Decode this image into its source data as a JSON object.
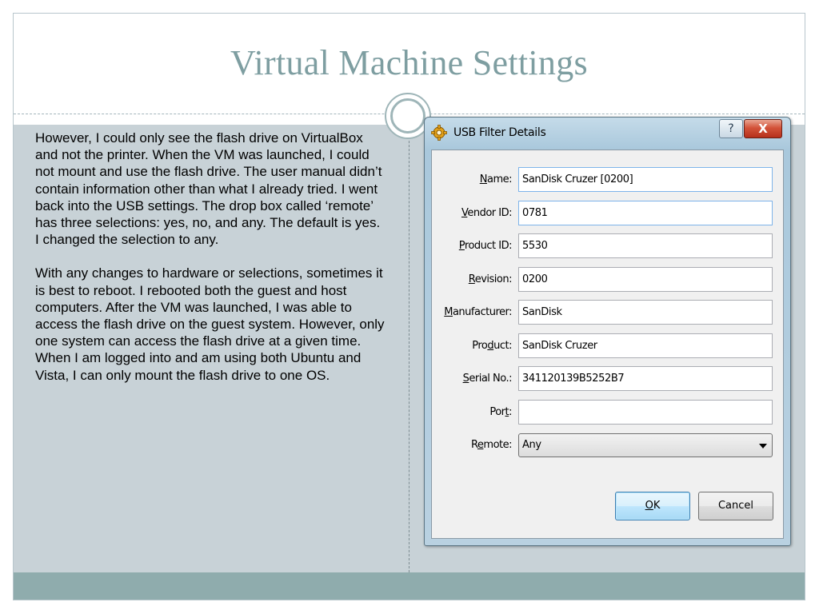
{
  "slide": {
    "title": "Virtual Machine Settings",
    "paragraphs": [
      "However, I could only see the flash drive on VirtualBox and not the printer.  When the VM was launched, I could not mount and use the flash drive.  The user manual didn’t contain information other than what I already tried.  I went back into the USB settings.  The drop box called ‘remote’ has three selections: yes, no, and any.  The default is yes.  I changed the selection to any.",
      "With any changes to hardware or selections, sometimes it is best to reboot.  I rebooted both the guest and host computers.  After the VM was launched, I was able to access the flash drive on the guest system.  However, only one system can access the flash drive at a given time.  When I am logged into and am using both Ubuntu and Vista, I can only mount the flash drive to one OS."
    ]
  },
  "dialog": {
    "title": "USB Filter Details",
    "icon": "gear-icon",
    "help_label": "?",
    "close_label": "X",
    "fields": {
      "name": {
        "label_pre": "",
        "label_u": "N",
        "label_post": "ame:",
        "value": "SanDisk Cruzer [0200]"
      },
      "vendor_id": {
        "label_pre": "",
        "label_u": "V",
        "label_post": "endor ID:",
        "value": "0781"
      },
      "product_id": {
        "label_pre": "",
        "label_u": "P",
        "label_post": "roduct ID:",
        "value": "5530"
      },
      "revision": {
        "label_pre": "",
        "label_u": "R",
        "label_post": "evision:",
        "value": "0200"
      },
      "manufacturer": {
        "label_pre": "",
        "label_u": "M",
        "label_post": "anufacturer:",
        "value": "SanDisk"
      },
      "product": {
        "label_pre": "Pro",
        "label_u": "d",
        "label_post": "uct:",
        "value": "SanDisk Cruzer"
      },
      "serial_no": {
        "label_pre": "",
        "label_u": "S",
        "label_post": "erial No.:",
        "value": "341120139B5252B7"
      },
      "port": {
        "label_pre": "Por",
        "label_u": "t",
        "label_post": ":",
        "value": ""
      },
      "remote": {
        "label_pre": "R",
        "label_u": "e",
        "label_post": "mote:",
        "value": "Any"
      }
    },
    "ok_u": "O",
    "ok_post": "K",
    "cancel_label": "Cancel"
  }
}
